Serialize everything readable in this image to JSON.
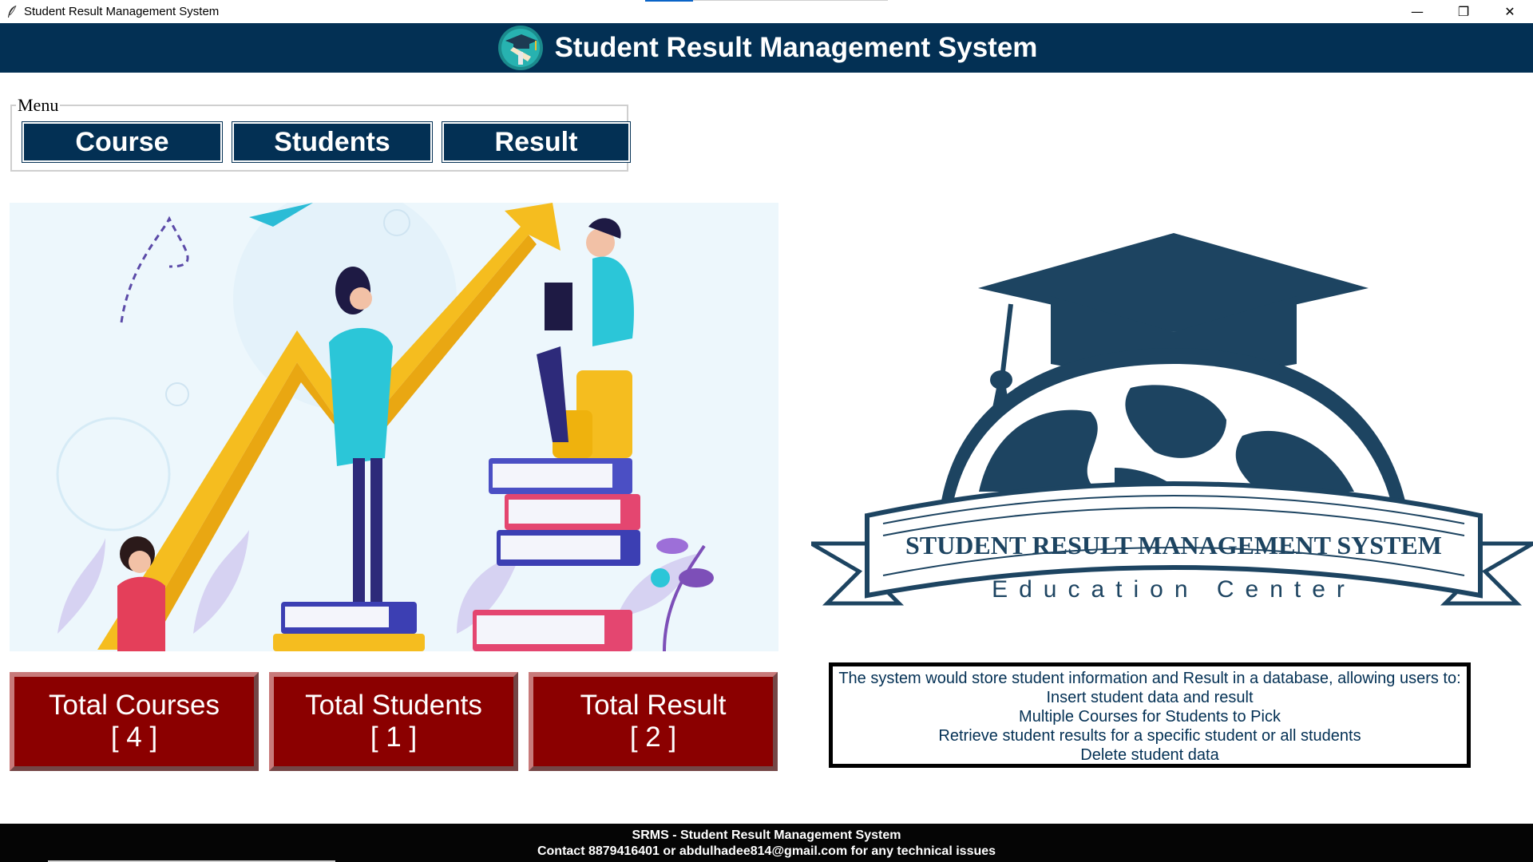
{
  "window": {
    "title": "Student Result Management System",
    "controls": {
      "minimize": "—",
      "maximize": "❐",
      "close": "✕"
    }
  },
  "header": {
    "title": "Student Result Management System",
    "background": "#033054"
  },
  "menu": {
    "legend": "Menu",
    "buttons": [
      {
        "label": "Course"
      },
      {
        "label": "Students"
      },
      {
        "label": "Result"
      }
    ]
  },
  "stats": [
    {
      "label": "Total Courses",
      "value": "[ 4 ]"
    },
    {
      "label": "Total Students",
      "value": "[ 1 ]"
    },
    {
      "label": "Total Result",
      "value": "[ 2 ]"
    }
  ],
  "logo": {
    "banner_text": "STUDENT RESULT MANAGEMENT SYSTEM",
    "subtitle": "Education Center",
    "color": "#1d4461"
  },
  "info": {
    "lines": [
      "The system would store student information and Result in a database, allowing users to:",
      "Insert student data and result",
      "Multiple Courses for Students to Pick",
      "Retrieve student results for a specific student or all students",
      "Delete student data"
    ]
  },
  "footer": {
    "line1": "SRMS - Student Result Management System",
    "line2": "Contact 8879416401 or abdulhadee814@gmail.com for any technical issues"
  },
  "colors": {
    "navy": "#033054",
    "stat_red": "#8b0000",
    "footer_bg": "#050505"
  }
}
